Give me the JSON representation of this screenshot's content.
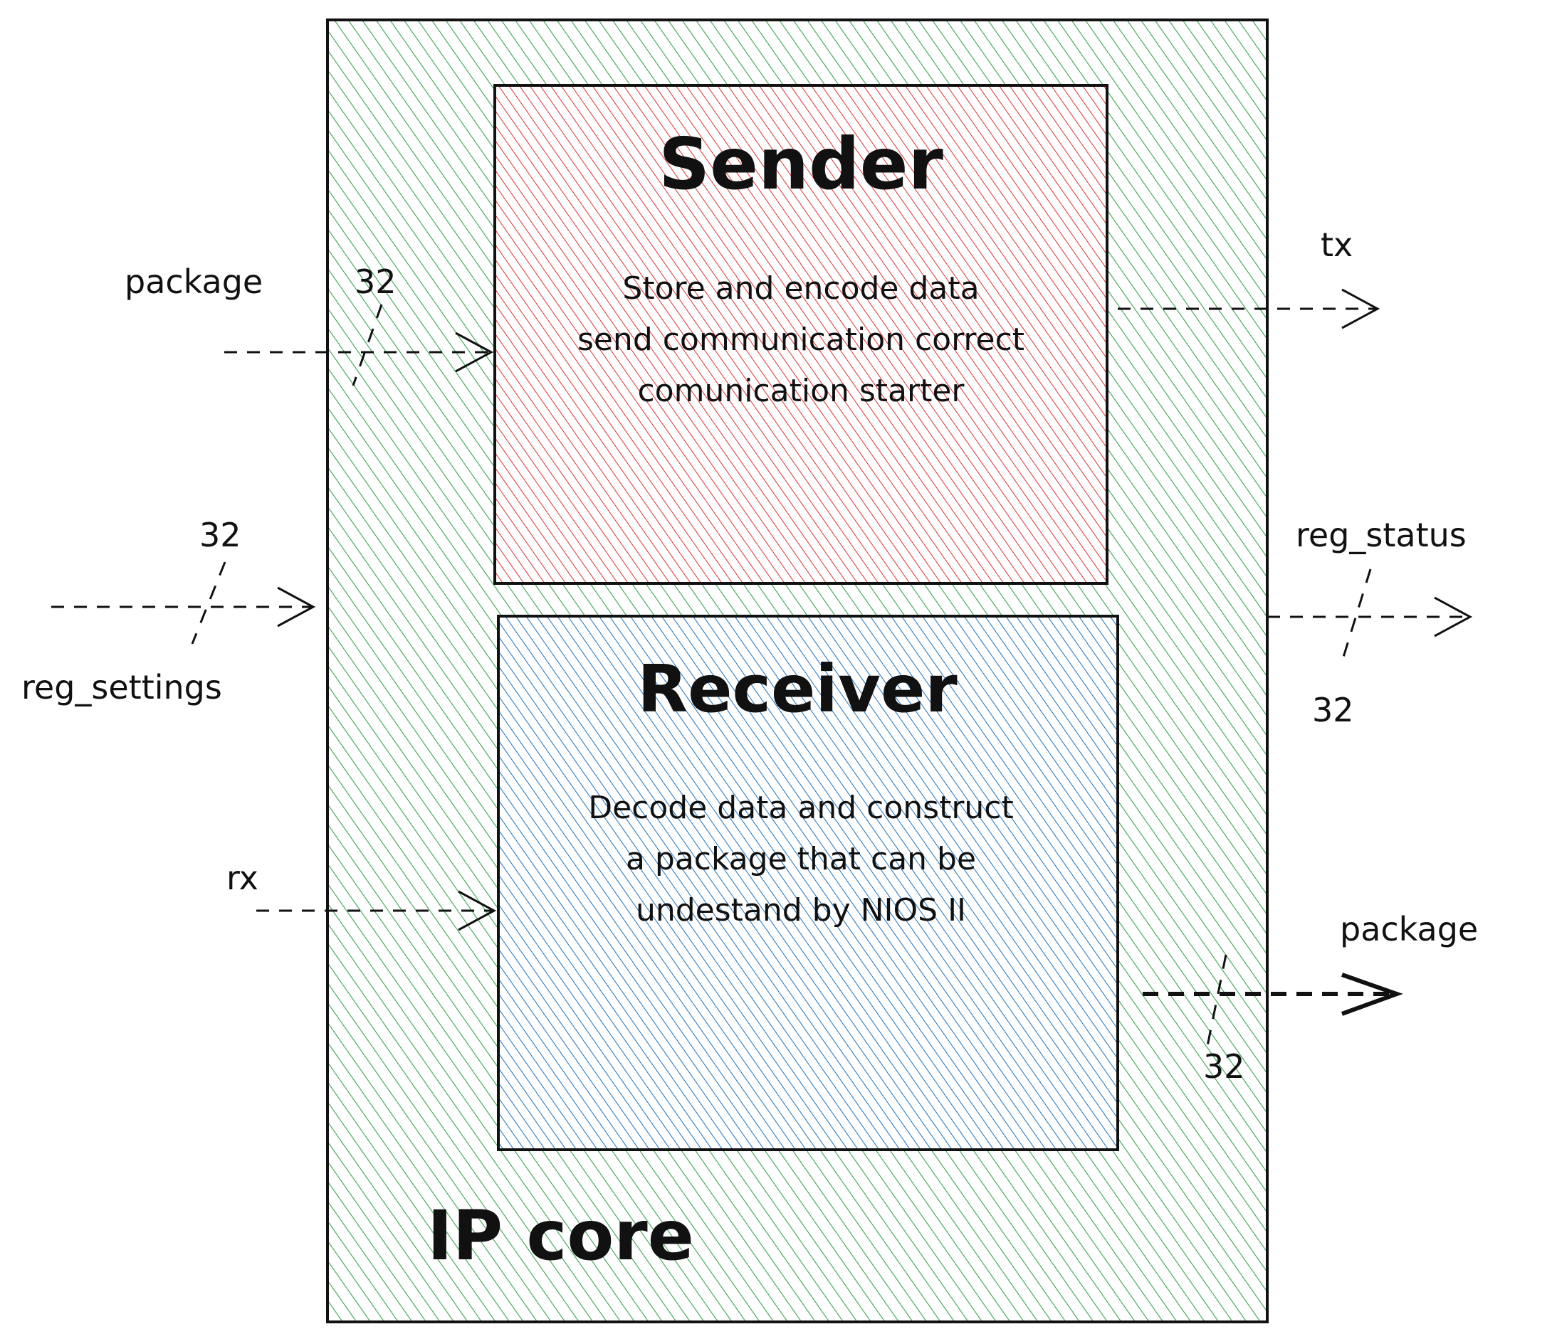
{
  "ip_core": {
    "title": "IP core"
  },
  "sender": {
    "title": "Sender",
    "description_lines": [
      "Store and encode data",
      "send communication correct",
      "comunication starter"
    ]
  },
  "receiver": {
    "title": "Receiver",
    "description_lines": [
      "Decode data and construct",
      "a package that can be",
      "undestand by NIOS II"
    ]
  },
  "signals": {
    "package_in": {
      "label": "package",
      "width": "32"
    },
    "reg_settings": {
      "label": "reg_settings",
      "width": "32"
    },
    "rx": {
      "label": "rx"
    },
    "tx": {
      "label": "tx"
    },
    "reg_status": {
      "label": "reg_status",
      "width": "32"
    },
    "package_out": {
      "label": "package",
      "width": "32"
    }
  },
  "colors": {
    "ip_core_fill": "#2f9e44",
    "sender_fill": "#e03131",
    "receiver_fill": "#1971c2",
    "stroke": "#111111"
  }
}
